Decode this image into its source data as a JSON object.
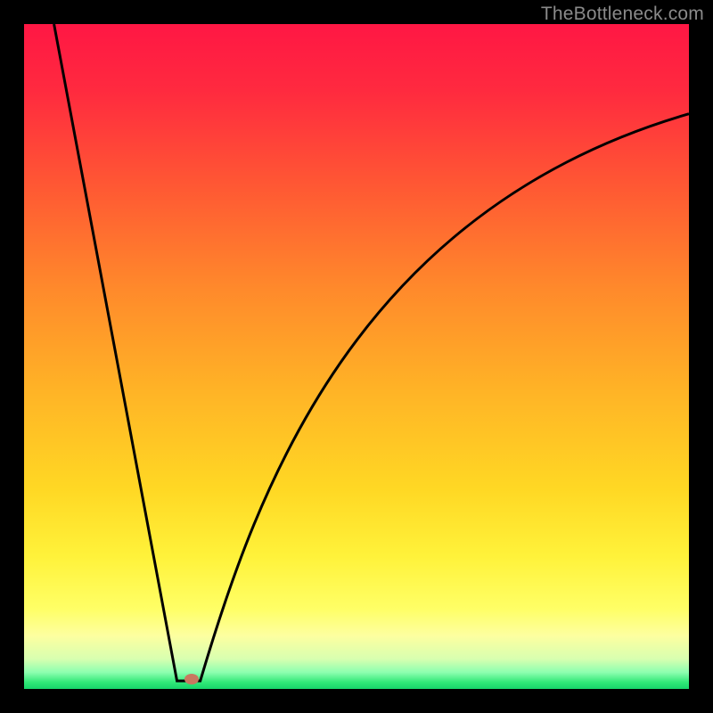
{
  "watermark": "TheBottleneck.com",
  "chart_data": {
    "type": "line",
    "title": "",
    "xlabel": "",
    "ylabel": "",
    "xlim": [
      0,
      100
    ],
    "ylim": [
      0,
      100
    ],
    "gradient_stops": [
      {
        "offset": 0.0,
        "color": "#ff1744"
      },
      {
        "offset": 0.1,
        "color": "#ff2a3f"
      },
      {
        "offset": 0.25,
        "color": "#ff5a33"
      },
      {
        "offset": 0.4,
        "color": "#ff8a2b"
      },
      {
        "offset": 0.55,
        "color": "#ffb326"
      },
      {
        "offset": 0.7,
        "color": "#ffd824"
      },
      {
        "offset": 0.8,
        "color": "#fff23a"
      },
      {
        "offset": 0.88,
        "color": "#ffff66"
      },
      {
        "offset": 0.92,
        "color": "#fdffa0"
      },
      {
        "offset": 0.955,
        "color": "#d8ffb0"
      },
      {
        "offset": 0.975,
        "color": "#8dffb0"
      },
      {
        "offset": 0.99,
        "color": "#30e878"
      },
      {
        "offset": 1.0,
        "color": "#17d46a"
      }
    ],
    "series": [
      {
        "name": "bottleneck-curve",
        "color": "#000000",
        "segments": [
          {
            "type": "line",
            "x1": 4.5,
            "y1": 100,
            "x2": 23,
            "y2": 1.2
          },
          {
            "type": "line",
            "x1": 23,
            "y1": 1.2,
            "x2": 26.5,
            "y2": 1.2
          },
          {
            "type": "bezier",
            "x1": 26.5,
            "y1": 1.2,
            "cx1": 35,
            "cy1": 30,
            "cx2": 50,
            "cy2": 72,
            "x2": 100,
            "y2": 86.5
          }
        ]
      }
    ],
    "marker": {
      "x": 25.2,
      "y": 1.5,
      "color": "#c97860"
    }
  }
}
